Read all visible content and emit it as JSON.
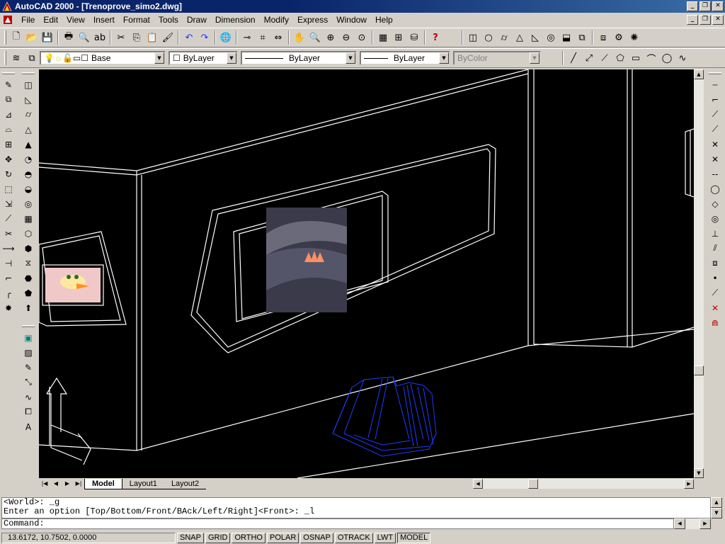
{
  "window": {
    "title": "AutoCAD 2000 - [Trenoprove_simo2.dwg]",
    "app_icon": "autocad-icon",
    "controls": [
      "minimize",
      "restore",
      "close"
    ]
  },
  "menubar": {
    "items": [
      "File",
      "Edit",
      "View",
      "Insert",
      "Format",
      "Tools",
      "Draw",
      "Dimension",
      "Modify",
      "Express",
      "Window",
      "Help"
    ]
  },
  "standard_toolbar": {
    "icons": [
      "new-icon",
      "open-icon",
      "save-icon",
      "print-icon",
      "print-preview-icon",
      "spell-check-icon",
      "cut-icon",
      "copy-icon",
      "paste-icon",
      "match-properties-icon",
      "undo-icon",
      "redo-icon",
      "hyperlink-icon",
      "object-snap-icon",
      "ucs-icon",
      "tracking-icon",
      "pan-icon",
      "zoom-realtime-icon",
      "zoom-window-icon",
      "zoom-previous-icon",
      "properties-icon",
      "design-center-icon",
      "dbconnect-icon",
      "help-icon"
    ]
  },
  "layers_toolbar": {
    "layer": "Base",
    "color": "ByLayer",
    "linetype": "ByLayer",
    "lineweight": "ByLayer",
    "plotstyle": "ByColor"
  },
  "tabs": {
    "items": [
      "Model",
      "Layout1",
      "Layout2"
    ],
    "active": "Model"
  },
  "command": {
    "history": [
      "<World>: _g",
      "Enter an option [Top/Bottom/Front/BAck/Left/Right]<Front>: _l"
    ],
    "prompt": "Command:"
  },
  "statusbar": {
    "coordinates": "13.6172, 10.7502, 0.0000",
    "toggles": [
      "SNAP",
      "GRID",
      "ORTHO",
      "POLAR",
      "OSNAP",
      "OTRACK",
      "LWT",
      "MODEL"
    ],
    "active_toggle": "MODEL"
  },
  "colors": {
    "titlebar": "#0a246a",
    "drawing_bg": "#000000",
    "wireframe": "#ffffff",
    "object_blue": "#1e3cff",
    "face": "#d4d0c8"
  }
}
